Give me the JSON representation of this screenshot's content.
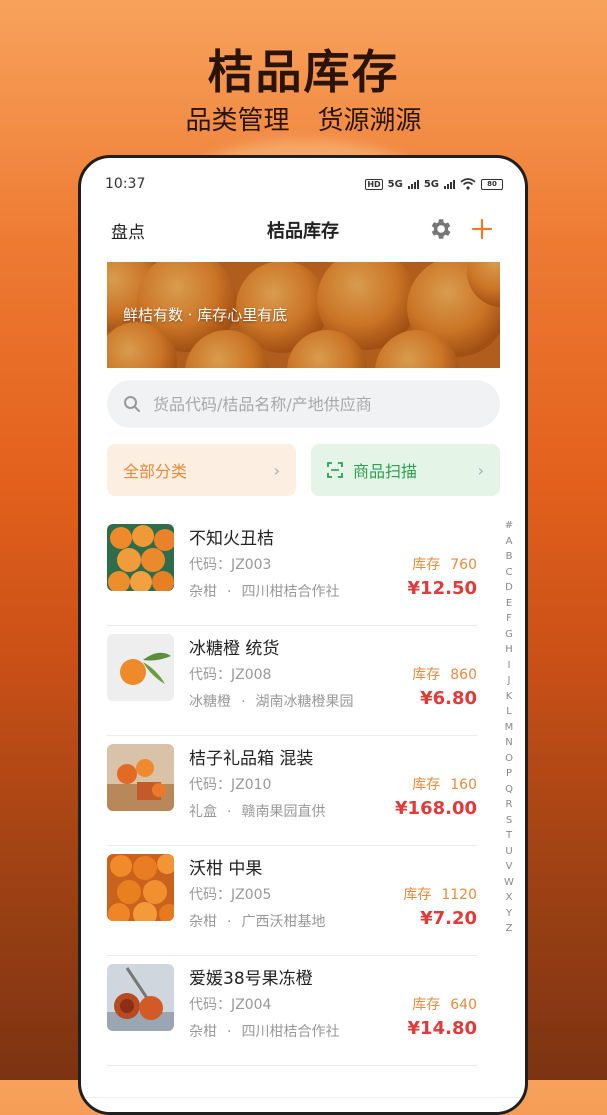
{
  "promo": {
    "title": "桔品库存",
    "subtitle_left": "品类管理",
    "subtitle_right": "货源溯源"
  },
  "status_bar": {
    "time": "10:37",
    "network_1": "5G",
    "network_2": "5G",
    "hd": "HD",
    "battery": "80"
  },
  "nav": {
    "left_label": "盘点",
    "title": "桔品库存",
    "settings_icon": "gear-icon",
    "add_icon": "plus-icon"
  },
  "banner": {
    "text": "鲜桔有数 · 库存心里有底"
  },
  "search": {
    "placeholder": "货品代码/桔品名称/产地供应商"
  },
  "filters": {
    "category_label": "全部分类",
    "scan_label": "商品扫描"
  },
  "items": [
    {
      "name": "不知火丑桔",
      "code": "代码：JZ003",
      "category": "杂柑",
      "supplier": "四川柑桔合作社",
      "stock_label": "库存",
      "stock": "760",
      "price": "¥12.50"
    },
    {
      "name": "冰糖橙 统货",
      "code": "代码：JZ008",
      "category": "冰糖橙",
      "supplier": "湖南冰糖橙果园",
      "stock_label": "库存",
      "stock": "860",
      "price": "¥6.80"
    },
    {
      "name": "桔子礼品箱 混装",
      "code": "代码：JZ010",
      "category": "礼盒",
      "supplier": "赣南果园直供",
      "stock_label": "库存",
      "stock": "160",
      "price": "¥168.00"
    },
    {
      "name": "沃柑 中果",
      "code": "代码：JZ005",
      "category": "杂柑",
      "supplier": "广西沃柑基地",
      "stock_label": "库存",
      "stock": "1120",
      "price": "¥7.20"
    },
    {
      "name": "爱媛38号果冻橙",
      "code": "代码：JZ004",
      "category": "杂柑",
      "supplier": "四川柑桔合作社",
      "stock_label": "库存",
      "stock": "640",
      "price": "¥14.80"
    }
  ],
  "alpha_index": [
    "#",
    "A",
    "B",
    "C",
    "D",
    "E",
    "F",
    "G",
    "H",
    "I",
    "J",
    "K",
    "L",
    "M",
    "N",
    "O",
    "P",
    "Q",
    "R",
    "S",
    "T",
    "U",
    "V",
    "W",
    "X",
    "Y",
    "Z"
  ],
  "colors": {
    "accent": "#ef7a22",
    "price": "#e03a3a",
    "stock": "#ea8a3e",
    "scan_green": "#2f9e4f"
  }
}
